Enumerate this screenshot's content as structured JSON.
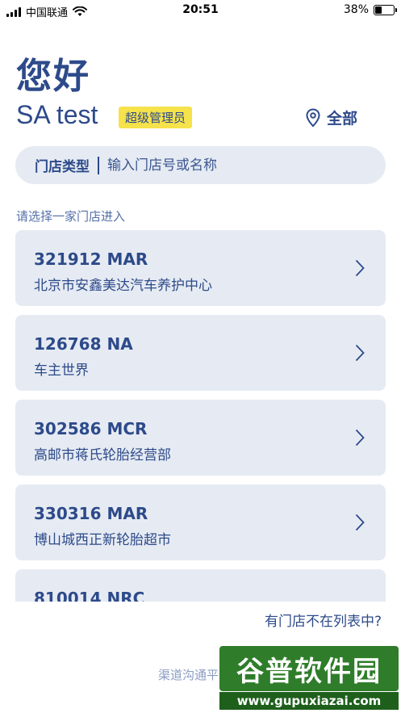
{
  "status_bar": {
    "carrier": "中国联通",
    "time": "20:51",
    "battery": "38%",
    "battery_level": 0.38,
    "icons": [
      "signal-icon",
      "wifi-icon",
      "battery-icon"
    ]
  },
  "header": {
    "greeting": "您好",
    "user_name": "SA test",
    "role": "超级管理员",
    "scope_label": "全部",
    "scope_icon": "location-pin-icon"
  },
  "search": {
    "type_label": "门店类型",
    "placeholder": "输入门店号或名称"
  },
  "prompt": "请选择一家门店进入",
  "stores": [
    {
      "code": "321912 MAR",
      "name": "北京市安鑫美达汽车养护中心"
    },
    {
      "code": "126768 NA",
      "name": "车主世界"
    },
    {
      "code": "302586 MCR",
      "name": "高邮市蒋氏轮胎经营部"
    },
    {
      "code": "330316 MAR",
      "name": "博山城西正新轮胎超市"
    },
    {
      "code": "810014 NRC",
      "name": ""
    }
  ],
  "not_listed_link": "有门店不在列表中?",
  "footer_text": "渠道沟通平",
  "watermark": {
    "title": "谷普软件园",
    "url": "www.gupuxiazai.com"
  },
  "colors": {
    "primary": "#2d4a8a",
    "card_bg": "#e6ebf3",
    "badge": "#f6e24a"
  }
}
